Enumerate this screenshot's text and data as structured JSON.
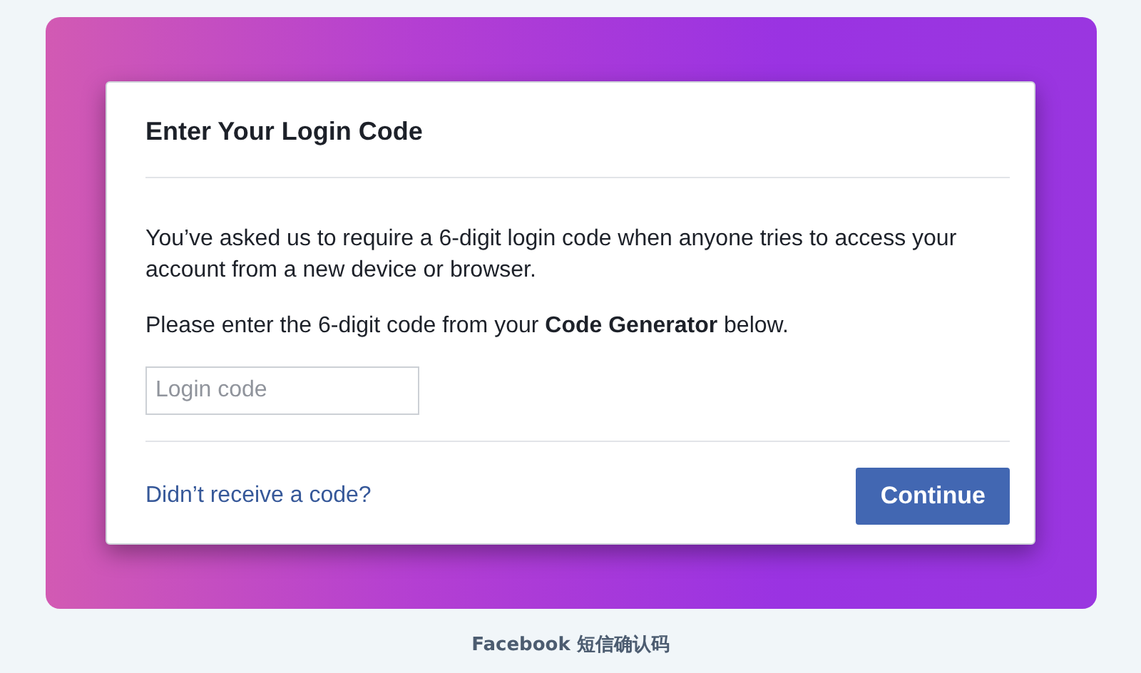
{
  "dialog": {
    "title": "Enter Your Login Code",
    "paragraphs": [
      "You’ve asked us to require a 6-digit login code when anyone tries to access your account from a new device or browser.",
      "Please enter the 6-digit code from your **Code Generator** below."
    ],
    "field": {
      "placeholder": "Login code"
    },
    "link": "Didn’t receive a code?",
    "button": "Continue"
  },
  "caption": "Facebook 短信确认码"
}
